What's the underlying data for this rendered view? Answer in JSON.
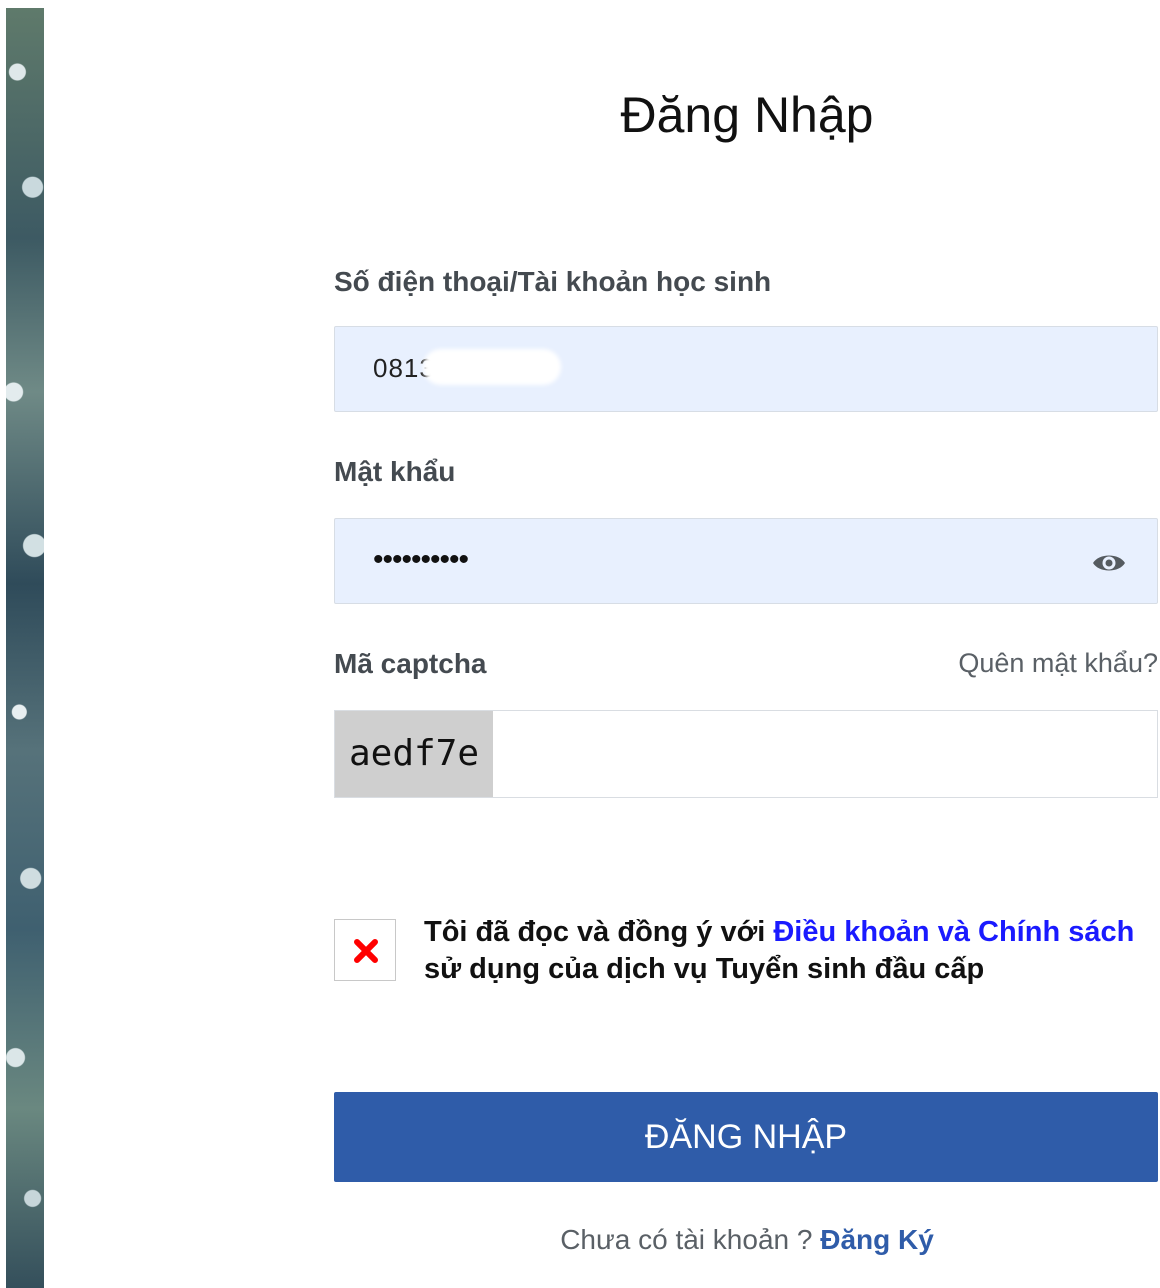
{
  "title": "Đăng Nhập",
  "account": {
    "label": "Số điện thoại/Tài khoản học sinh",
    "value": "0813"
  },
  "password": {
    "label": "Mật khẩu",
    "masked_value": "••••••••••",
    "toggle_icon": "eye-icon"
  },
  "captcha": {
    "label": "Mã captcha",
    "code": "aedf7e",
    "input_value": ""
  },
  "forgot_password": "Quên mật khẩu?",
  "terms": {
    "checked": false,
    "checkbox_icon": "x-icon",
    "checkbox_icon_color": "#ff0000",
    "text_before": "Tôi đã đọc và đồng ý với ",
    "link_text": "Điều khoản và Chính sách",
    "text_after": " sử dụng của dịch vụ Tuyển sinh đầu cấp"
  },
  "login_button": "ĐĂNG NHẬP",
  "signup": {
    "prompt": "Chưa có tài khoản ? ",
    "link": "Đăng Ký"
  },
  "colors": {
    "primary": "#2f5ca9",
    "input_bg": "#e8f0fe",
    "link_blue": "#1a1aff"
  }
}
